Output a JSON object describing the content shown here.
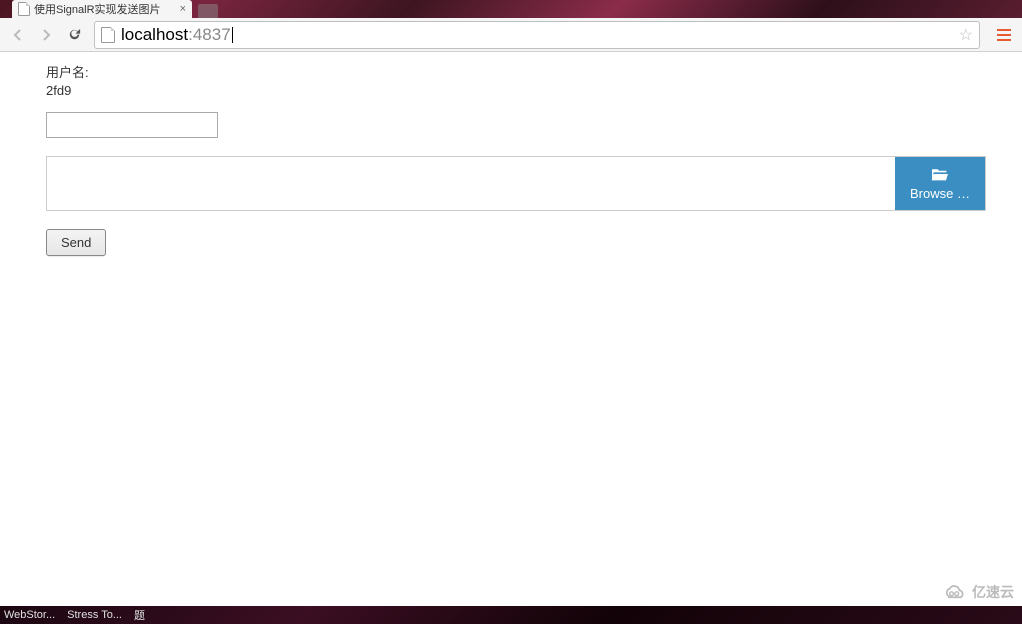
{
  "browser": {
    "tab_title": "使用SignalR实现发送图片",
    "address_host": "localhost",
    "address_port": ":4837"
  },
  "content": {
    "username_label": "用户名:",
    "username_value": "2fd9",
    "text_input_value": "",
    "file_display_value": "",
    "browse_label": "Browse …",
    "send_label": "Send"
  },
  "taskbar": {
    "items": [
      "WebStor...",
      "Stress To...",
      "题"
    ]
  },
  "watermark": {
    "text": "亿速云"
  }
}
